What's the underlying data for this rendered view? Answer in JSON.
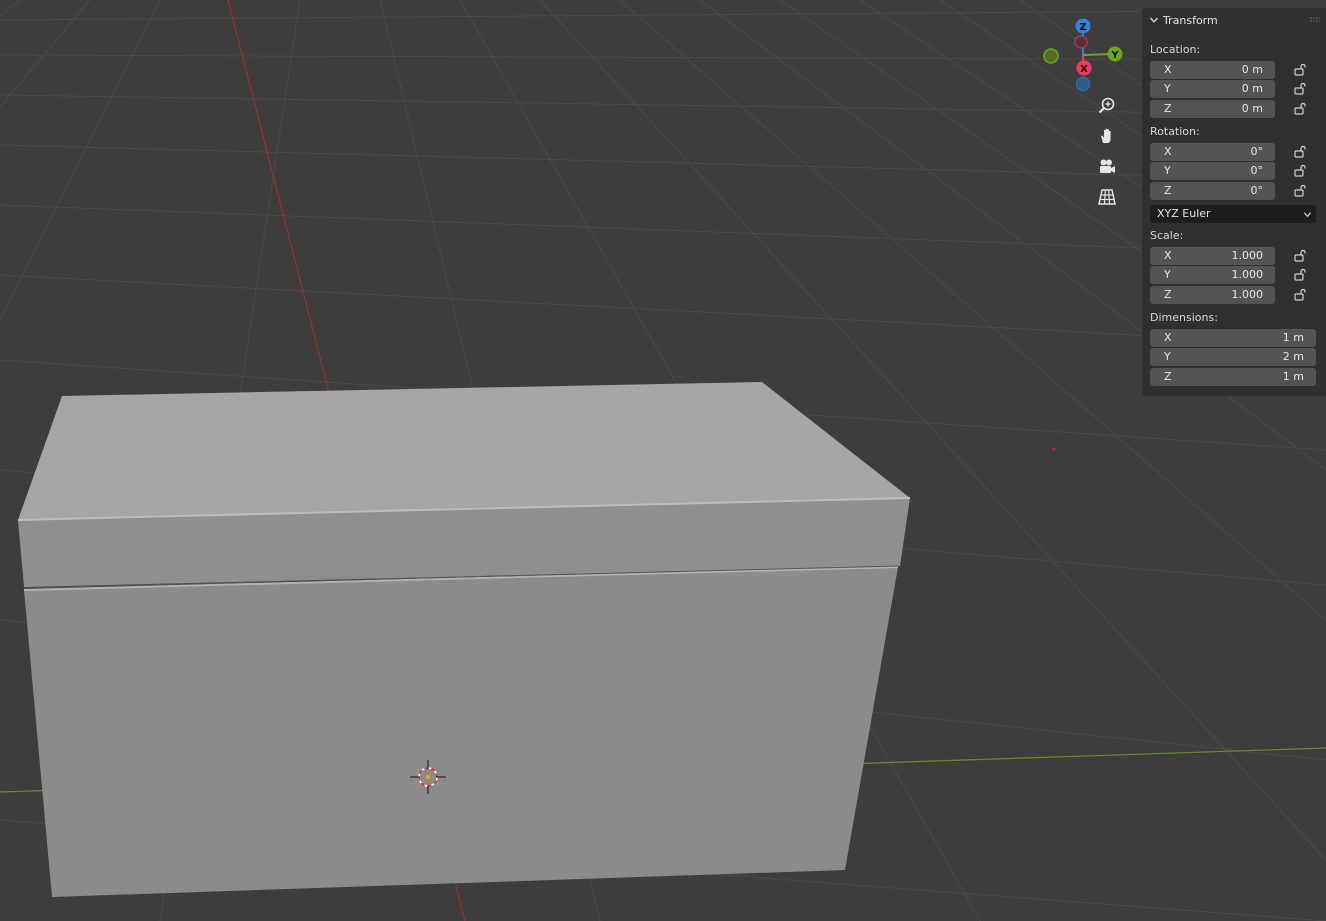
{
  "viewport": {
    "colors": {
      "background": "#3d3d3d",
      "grid": "#4a4a4a",
      "x_axis": "#9b2f2f",
      "y_axis": "#6b8f23",
      "box_top": "#a8a8a8",
      "box_front": "#8d8d8d"
    },
    "gizmo": {
      "z_label": "Z",
      "y_label": "Y",
      "x_label": "X",
      "colors": {
        "x": "#f2385a",
        "y": "#6ca81b",
        "z": "#2f84e3"
      }
    },
    "nav_icons": [
      "zoom-icon",
      "hand-icon",
      "camera-icon",
      "grid-icon"
    ]
  },
  "transform": {
    "title": "Transform",
    "location_label": "Location:",
    "location": [
      {
        "axis": "X",
        "value": "0 m"
      },
      {
        "axis": "Y",
        "value": "0 m"
      },
      {
        "axis": "Z",
        "value": "0 m"
      }
    ],
    "rotation_label": "Rotation:",
    "rotation": [
      {
        "axis": "X",
        "value": "0°"
      },
      {
        "axis": "Y",
        "value": "0°"
      },
      {
        "axis": "Z",
        "value": "0°"
      }
    ],
    "rotation_mode": "XYZ Euler",
    "scale_label": "Scale:",
    "scale": [
      {
        "axis": "X",
        "value": "1.000"
      },
      {
        "axis": "Y",
        "value": "1.000"
      },
      {
        "axis": "Z",
        "value": "1.000"
      }
    ],
    "dimensions_label": "Dimensions:",
    "dimensions": [
      {
        "axis": "X",
        "value": "1 m"
      },
      {
        "axis": "Y",
        "value": "2 m"
      },
      {
        "axis": "Z",
        "value": "1 m"
      }
    ]
  }
}
